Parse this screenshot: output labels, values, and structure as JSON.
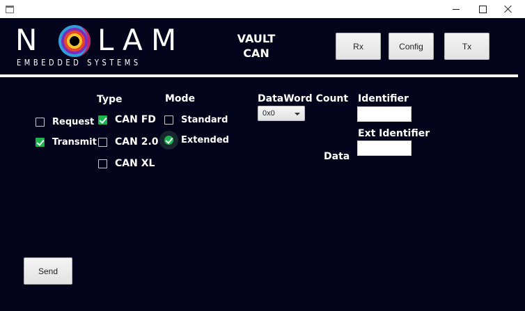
{
  "window": {
    "minimize_glyph": "",
    "maximize_glyph": "",
    "close_glyph": ""
  },
  "logo": {
    "letters": [
      "N",
      "L",
      "A",
      "M"
    ],
    "tagline": "EMBEDDED SYSTEMS"
  },
  "header": {
    "title_line1": "VAULT",
    "title_line2": "CAN"
  },
  "toolbar": {
    "rx_label": "Rx",
    "config_label": "Config",
    "tx_label": "Tx"
  },
  "form": {
    "type_heading": "Type",
    "mode_heading": "Mode",
    "dataword_heading": "DataWord Count",
    "identifier_heading": "Identifier",
    "ext_identifier_heading": "Ext Identifier",
    "data_heading": "Data",
    "request_label": "Request",
    "transmit_label": "Transmit",
    "can_fd_label": "CAN FD",
    "can_20_label": "CAN 2.0",
    "can_xl_label": "CAN XL",
    "standard_label": "Standard",
    "extended_label": "Extended",
    "dataword_value": "0x0",
    "identifier_value": "",
    "ext_identifier_value": ""
  },
  "checked": {
    "request": false,
    "transmit": true,
    "can_fd": true,
    "can_20": false,
    "can_xl": false,
    "standard": false,
    "extended": true
  },
  "actions": {
    "send_label": "Send"
  },
  "colors": {
    "background": "#04031c",
    "checkbox_checked": "#1cb34f",
    "text": "#ffffff"
  }
}
